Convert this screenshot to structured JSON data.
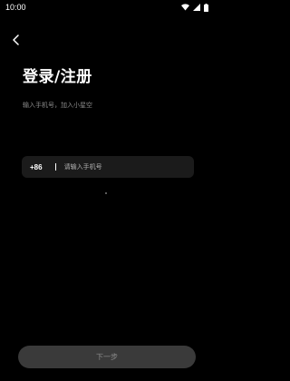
{
  "status_bar": {
    "time": "10:00",
    "icons": [
      "wifi-icon",
      "signal-icon",
      "battery-icon"
    ]
  },
  "header": {
    "back_icon": "back-arrow-icon",
    "title": "登录/注册",
    "subtitle": "输入手机号，加入小星空"
  },
  "phone_field": {
    "country_code": "+86",
    "value": "",
    "placeholder": "请输入手机号"
  },
  "footer": {
    "next_label": "下一步"
  },
  "colors": {
    "background": "#000000",
    "field_background": "#1b1b1b",
    "button_background": "#3a3a3a",
    "button_text": "#8a8a8a",
    "subtitle_text": "#8b8b8b"
  }
}
